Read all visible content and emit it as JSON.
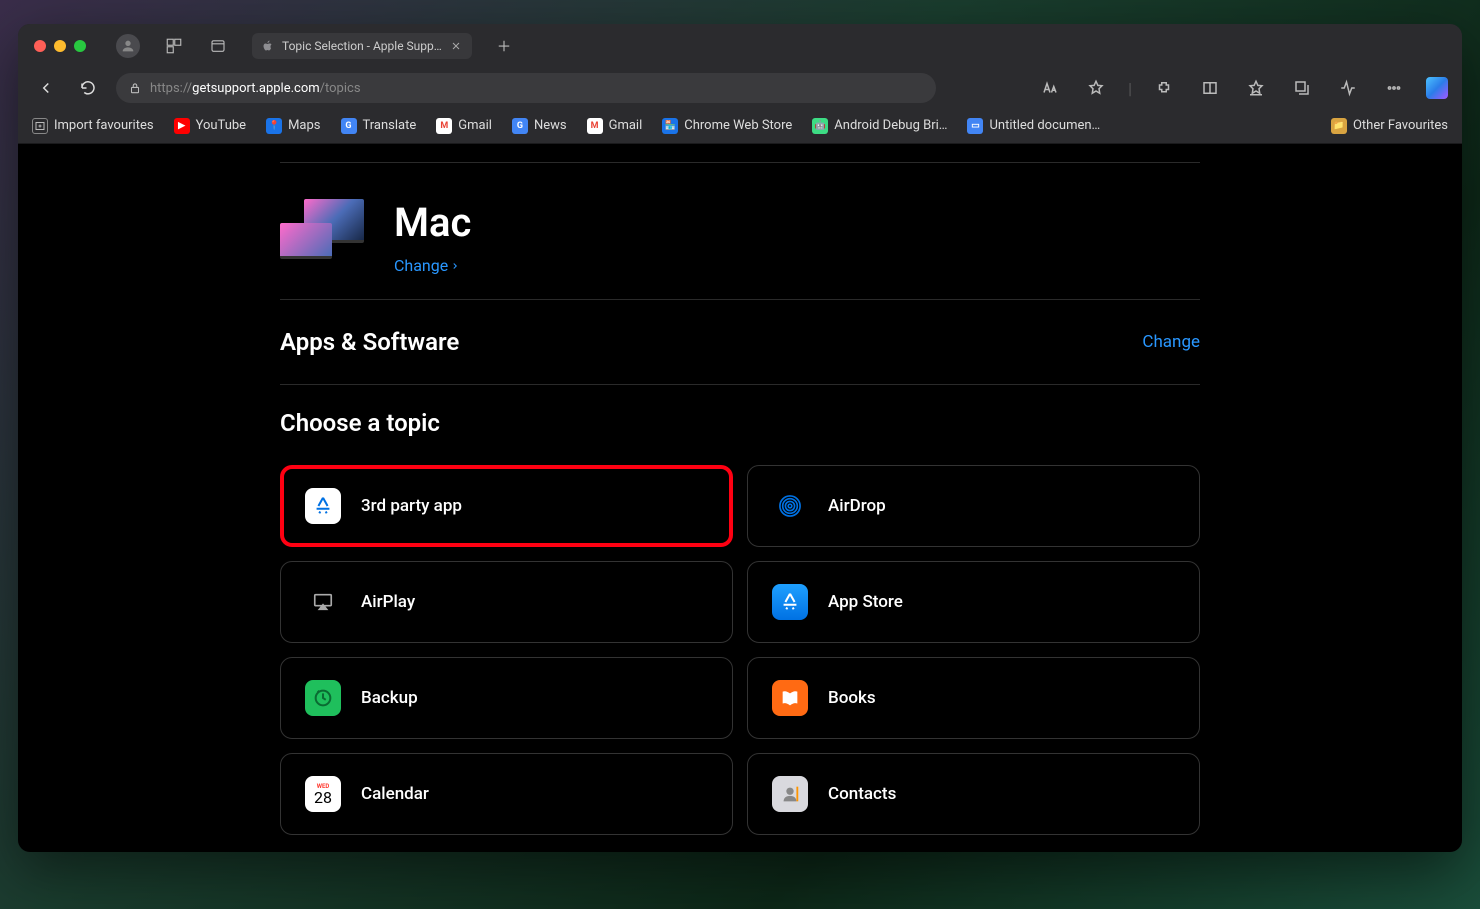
{
  "tab": {
    "title": "Topic Selection - Apple Support"
  },
  "url": {
    "prefix": "https://",
    "host": "getsupport.apple.com",
    "path": "/topics"
  },
  "bookmarks": [
    "Import favourites",
    "YouTube",
    "Maps",
    "Translate",
    "Gmail",
    "News",
    "Gmail",
    "Chrome Web Store",
    "Android Debug Bri…",
    "Untitled documen…"
  ],
  "other_fav": "Other Favourites",
  "product": {
    "title": "Mac",
    "change": "Change"
  },
  "category": {
    "title": "Apps & Software",
    "change": "Change"
  },
  "choose_label": "Choose a topic",
  "topics": [
    {
      "label": "3rd party app",
      "icon": "appstore-white"
    },
    {
      "label": "AirDrop",
      "icon": "airdrop"
    },
    {
      "label": "AirPlay",
      "icon": "airplay"
    },
    {
      "label": "App Store",
      "icon": "appstore-blue"
    },
    {
      "label": "Backup",
      "icon": "backup"
    },
    {
      "label": "Books",
      "icon": "books"
    },
    {
      "label": "Calendar",
      "icon": "calendar"
    },
    {
      "label": "Contacts",
      "icon": "contacts"
    }
  ],
  "cal": {
    "day": "WED",
    "date": "28"
  }
}
